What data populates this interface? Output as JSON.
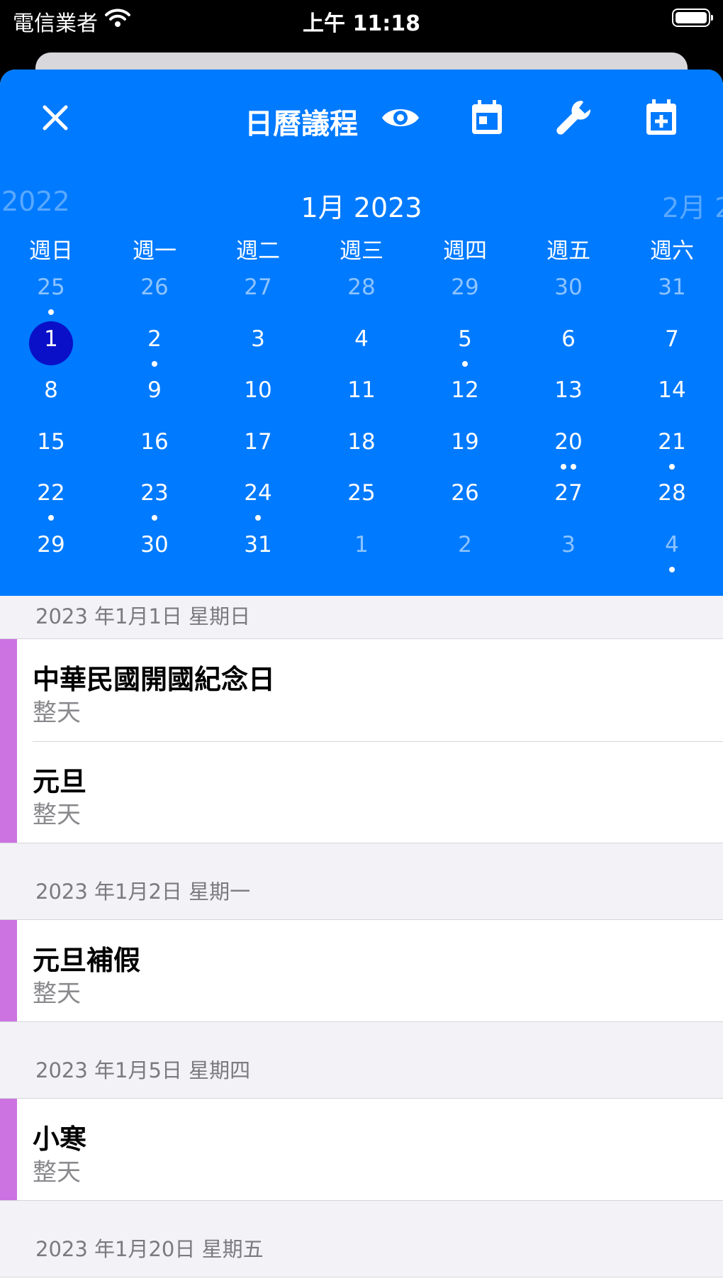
{
  "status_bar": {
    "carrier": "電信業者",
    "time": "上午 11:18"
  },
  "header": {
    "title": "日曆議程"
  },
  "calendar": {
    "prev_label": "2022",
    "month_label": "1月 2023",
    "next_label": "2月 2",
    "weekdays": [
      "週日",
      "週一",
      "週二",
      "週三",
      "週四",
      "週五",
      "週六"
    ],
    "weeks": [
      [
        {
          "d": "25",
          "muted": true,
          "dots": 1
        },
        {
          "d": "26",
          "muted": true,
          "dots": 0
        },
        {
          "d": "27",
          "muted": true,
          "dots": 0
        },
        {
          "d": "28",
          "muted": true,
          "dots": 0
        },
        {
          "d": "29",
          "muted": true,
          "dots": 0
        },
        {
          "d": "30",
          "muted": true,
          "dots": 0
        },
        {
          "d": "31",
          "muted": true,
          "dots": 0
        }
      ],
      [
        {
          "d": "1",
          "muted": false,
          "dots": 0,
          "selected": true
        },
        {
          "d": "2",
          "muted": false,
          "dots": 1
        },
        {
          "d": "3",
          "muted": false,
          "dots": 0
        },
        {
          "d": "4",
          "muted": false,
          "dots": 0
        },
        {
          "d": "5",
          "muted": false,
          "dots": 1
        },
        {
          "d": "6",
          "muted": false,
          "dots": 0
        },
        {
          "d": "7",
          "muted": false,
          "dots": 0
        }
      ],
      [
        {
          "d": "8",
          "muted": false,
          "dots": 0
        },
        {
          "d": "9",
          "muted": false,
          "dots": 0
        },
        {
          "d": "10",
          "muted": false,
          "dots": 0
        },
        {
          "d": "11",
          "muted": false,
          "dots": 0
        },
        {
          "d": "12",
          "muted": false,
          "dots": 0
        },
        {
          "d": "13",
          "muted": false,
          "dots": 0
        },
        {
          "d": "14",
          "muted": false,
          "dots": 0
        }
      ],
      [
        {
          "d": "15",
          "muted": false,
          "dots": 0
        },
        {
          "d": "16",
          "muted": false,
          "dots": 0
        },
        {
          "d": "17",
          "muted": false,
          "dots": 0
        },
        {
          "d": "18",
          "muted": false,
          "dots": 0
        },
        {
          "d": "19",
          "muted": false,
          "dots": 0
        },
        {
          "d": "20",
          "muted": false,
          "dots": 2
        },
        {
          "d": "21",
          "muted": false,
          "dots": 1
        }
      ],
      [
        {
          "d": "22",
          "muted": false,
          "dots": 1
        },
        {
          "d": "23",
          "muted": false,
          "dots": 1
        },
        {
          "d": "24",
          "muted": false,
          "dots": 1
        },
        {
          "d": "25",
          "muted": false,
          "dots": 0
        },
        {
          "d": "26",
          "muted": false,
          "dots": 0
        },
        {
          "d": "27",
          "muted": false,
          "dots": 0
        },
        {
          "d": "28",
          "muted": false,
          "dots": 0
        }
      ],
      [
        {
          "d": "29",
          "muted": false,
          "dots": 0
        },
        {
          "d": "30",
          "muted": false,
          "dots": 0
        },
        {
          "d": "31",
          "muted": false,
          "dots": 0
        },
        {
          "d": "1",
          "muted": true,
          "dots": 0
        },
        {
          "d": "2",
          "muted": true,
          "dots": 0
        },
        {
          "d": "3",
          "muted": true,
          "dots": 0
        },
        {
          "d": "4",
          "muted": true,
          "dots": 1
        }
      ]
    ]
  },
  "agenda": [
    {
      "date": "2023 年1月1日 星期日",
      "events": [
        {
          "title": "中華民國開國紀念日",
          "sub": "整天"
        },
        {
          "title": "元旦",
          "sub": "整天"
        }
      ]
    },
    {
      "date": "2023 年1月2日 星期一",
      "events": [
        {
          "title": "元旦補假",
          "sub": "整天"
        }
      ]
    },
    {
      "date": "2023 年1月5日 星期四",
      "events": [
        {
          "title": "小寒",
          "sub": "整天"
        }
      ]
    },
    {
      "date": "2023 年1月20日 星期五",
      "events": []
    }
  ],
  "colors": {
    "header_blue": "#007aff",
    "selected_day": "#0a10c8",
    "event_bar": "#cc73e1",
    "list_bg": "#f2f2f7"
  },
  "icons": {
    "close": "close-icon",
    "visibility": "eye-icon",
    "today": "calendar-today-icon",
    "settings": "wrench-icon",
    "add_event": "calendar-add-icon"
  }
}
